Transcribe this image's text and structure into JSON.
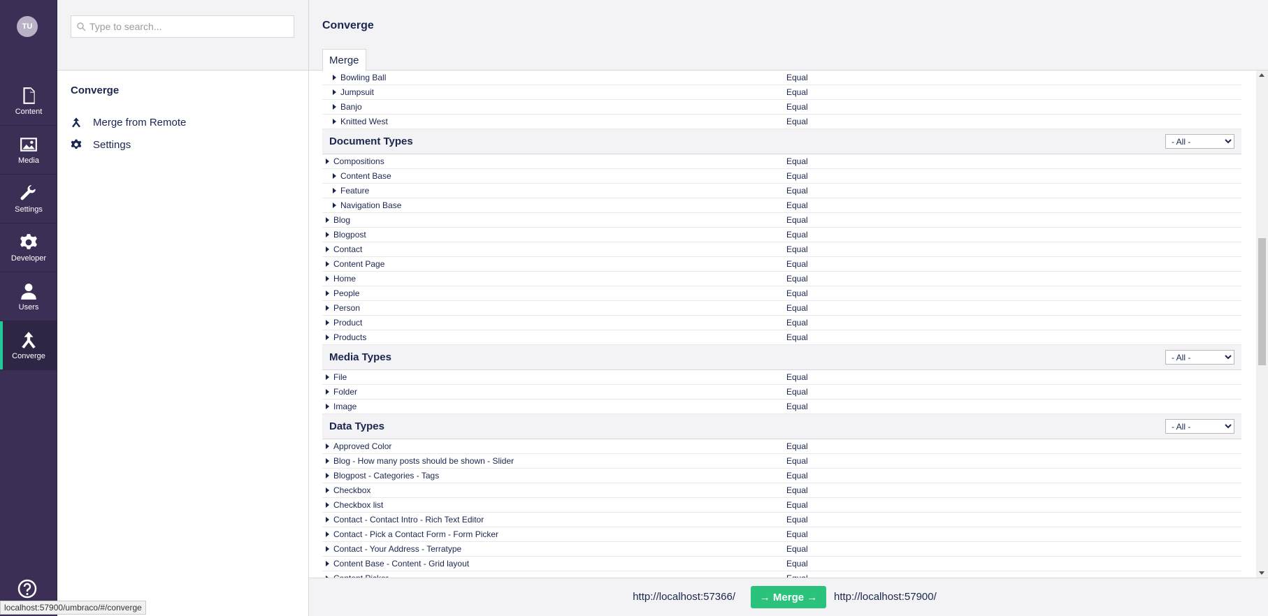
{
  "rail": {
    "avatar_initials": "TU",
    "items": [
      {
        "label": "Content",
        "icon": "document-icon"
      },
      {
        "label": "Media",
        "icon": "image-icon"
      },
      {
        "label": "Settings",
        "icon": "wrench-icon"
      },
      {
        "label": "Developer",
        "icon": "gear-icon"
      },
      {
        "label": "Users",
        "icon": "user-icon"
      },
      {
        "label": "Converge",
        "icon": "merge-icon"
      }
    ]
  },
  "tree": {
    "search_placeholder": "Type to search...",
    "title": "Converge",
    "nodes": [
      {
        "label": "Merge from Remote",
        "icon": "merge-icon"
      },
      {
        "label": "Settings",
        "icon": "gear-icon"
      }
    ]
  },
  "main": {
    "title": "Converge",
    "tab_label": "Merge",
    "filter_option": "- All -",
    "status_text": "Equal",
    "top_rows": [
      "Bowling Ball",
      "Jumpsuit",
      "Banjo",
      "Knitted West"
    ],
    "sections": [
      {
        "title": "Document Types",
        "rows": [
          {
            "name": "Compositions",
            "indent": 0
          },
          {
            "name": "Content Base",
            "indent": 1
          },
          {
            "name": "Feature",
            "indent": 1
          },
          {
            "name": "Navigation Base",
            "indent": 1
          },
          {
            "name": "Blog",
            "indent": 0
          },
          {
            "name": "Blogpost",
            "indent": 0
          },
          {
            "name": "Contact",
            "indent": 0
          },
          {
            "name": "Content Page",
            "indent": 0
          },
          {
            "name": "Home",
            "indent": 0
          },
          {
            "name": "People",
            "indent": 0
          },
          {
            "name": "Person",
            "indent": 0
          },
          {
            "name": "Product",
            "indent": 0
          },
          {
            "name": "Products",
            "indent": 0
          }
        ]
      },
      {
        "title": "Media Types",
        "rows": [
          {
            "name": "File",
            "indent": 0
          },
          {
            "name": "Folder",
            "indent": 0
          },
          {
            "name": "Image",
            "indent": 0
          }
        ]
      },
      {
        "title": "Data Types",
        "rows": [
          {
            "name": "Approved Color",
            "indent": 0
          },
          {
            "name": "Blog - How many posts should be shown - Slider",
            "indent": 0
          },
          {
            "name": "Blogpost - Categories - Tags",
            "indent": 0
          },
          {
            "name": "Checkbox",
            "indent": 0
          },
          {
            "name": "Checkbox list",
            "indent": 0
          },
          {
            "name": "Contact - Contact Intro - Rich Text Editor",
            "indent": 0
          },
          {
            "name": "Contact - Pick a Contact Form - Form Picker",
            "indent": 0
          },
          {
            "name": "Contact - Your Address - Terratype",
            "indent": 0
          },
          {
            "name": "Content Base - Content - Grid layout",
            "indent": 0
          },
          {
            "name": "Content Picker",
            "indent": 0
          }
        ]
      }
    ]
  },
  "footer": {
    "remote_url": "http://localhost:57366/",
    "merge_label": "→ Merge →",
    "local_url": "http://localhost:57900/"
  },
  "status_bar": "localhost:57900/umbraco/#/converge",
  "colors": {
    "rail_bg": "#3b2f55",
    "active_accent": "#20c997",
    "merge_button": "#2bc37c",
    "panel_bg": "#f3f3f5",
    "text": "#1b264f"
  }
}
